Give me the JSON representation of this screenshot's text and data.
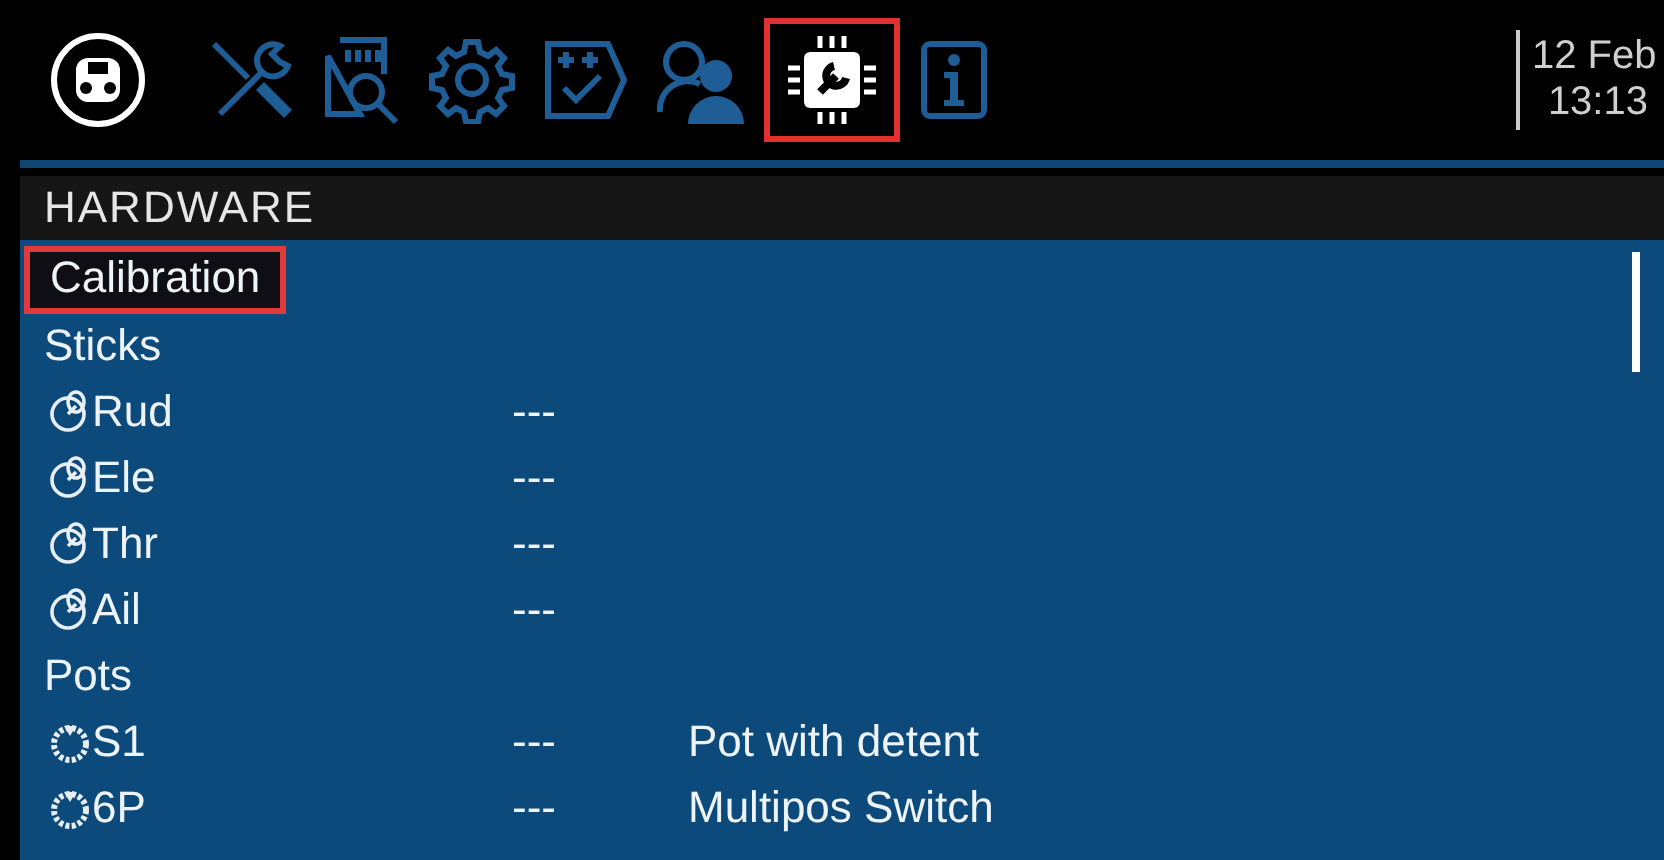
{
  "home": {
    "kind": "radio"
  },
  "tabs": [
    {
      "kind": "tools",
      "selected": false
    },
    {
      "kind": "sdcard",
      "selected": false
    },
    {
      "kind": "gear",
      "selected": false
    },
    {
      "kind": "checklist",
      "selected": false
    },
    {
      "kind": "users",
      "selected": false
    },
    {
      "kind": "chip",
      "selected": true
    },
    {
      "kind": "info",
      "selected": false
    }
  ],
  "datetime": {
    "date": "12 Feb",
    "time": "13:13"
  },
  "header": {
    "title": "HARDWARE"
  },
  "items": [
    {
      "kind": "button",
      "label": "Calibration",
      "selected": true
    },
    {
      "kind": "section",
      "label": "Sticks"
    },
    {
      "kind": "stick",
      "label": "Rud",
      "value": "---"
    },
    {
      "kind": "stick",
      "label": "Ele",
      "value": "---"
    },
    {
      "kind": "stick",
      "label": "Thr",
      "value": "---"
    },
    {
      "kind": "stick",
      "label": "Ail",
      "value": "---"
    },
    {
      "kind": "section",
      "label": "Pots"
    },
    {
      "kind": "pot",
      "label": "S1",
      "value": "---",
      "type": "Pot with detent"
    },
    {
      "kind": "pot",
      "label": "6P",
      "value": "---",
      "type": "Multipos Switch"
    }
  ]
}
